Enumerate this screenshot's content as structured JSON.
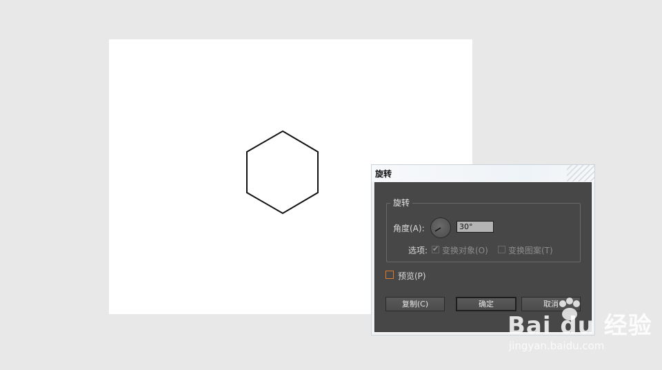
{
  "dialog": {
    "title": "旋转",
    "group_title": "旋转",
    "angle_label": "角度(A):",
    "angle_value": "30°",
    "options_label": "选项:",
    "option_transform_objects": "变换对象(O)",
    "option_transform_objects_checked": true,
    "option_transform_patterns": "变换图案(T)",
    "option_transform_patterns_checked": false,
    "preview_label": "预览(P)",
    "preview_checked": false,
    "copy_button": "复制(C)",
    "ok_button": "确定",
    "cancel_button": "取消"
  },
  "watermark": {
    "brand": "Bai du 经验",
    "url": "jingyan.baidu.com"
  }
}
